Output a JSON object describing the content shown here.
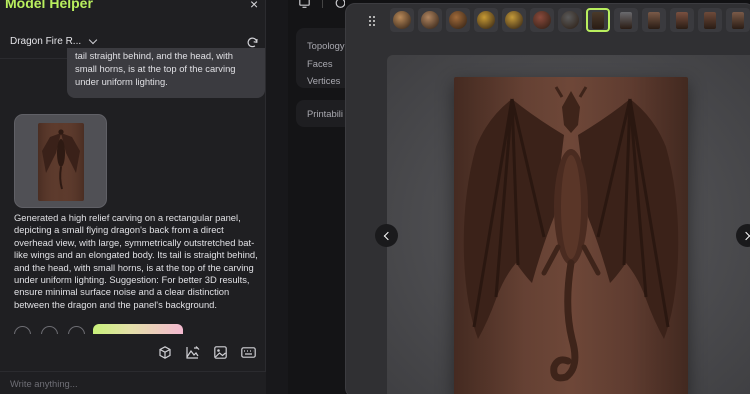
{
  "panel": {
    "title": "Model Helper",
    "close_icon": "×",
    "model_name": "Dragon Fire R...",
    "refresh_icon": "refresh-icon"
  },
  "chat": {
    "user_message": "tail straight behind, and the head, with small horns, is at the top of the carving under uniform lighting.",
    "assistant_message": "Generated a high relief carving on a rectangular panel, depicting a small flying dragon's back from a direct overhead view, with large, symmetrically outstretched bat-like wings and an elongated body. Its tail is straight behind, and the head, with small horns, is at the top of the carving under uniform lighting. Suggestion: For better 3D results, ensure minimal surface noise and a clear distinction between the dragon and the panel's background.",
    "input_placeholder": "Write anything..."
  },
  "toolbar": {
    "tools": [
      "cube-icon",
      "image-edit-icon",
      "image-add-icon",
      "keyboard-icon"
    ]
  },
  "model_info": {
    "labels": [
      "Topology",
      "Faces",
      "Vertices"
    ],
    "printability_label": "Printabili"
  },
  "thumbnails": [
    {
      "type": "medallion",
      "color": "#b98a5a"
    },
    {
      "type": "medallion",
      "color": "#b08560"
    },
    {
      "type": "medallion",
      "color": "#a06a3a"
    },
    {
      "type": "medallion",
      "color": "#c79a34"
    },
    {
      "type": "medallion",
      "color": "#c49a3a"
    },
    {
      "type": "medallion",
      "color": "#8a4a3c"
    },
    {
      "type": "medallion",
      "color": "#5a5a5a"
    },
    {
      "type": "panel",
      "color": "#4a3a2a",
      "selected": true
    },
    {
      "type": "panel",
      "color": "#6a6a6e"
    },
    {
      "type": "panel",
      "color": "#7a5a48"
    },
    {
      "type": "panel",
      "color": "#7a5040"
    },
    {
      "type": "panel",
      "color": "#6e4a3a"
    },
    {
      "type": "panel",
      "color": "#7a5a48"
    }
  ],
  "colors": {
    "accent": "#b9ef5e",
    "wood": "#6a4436"
  }
}
